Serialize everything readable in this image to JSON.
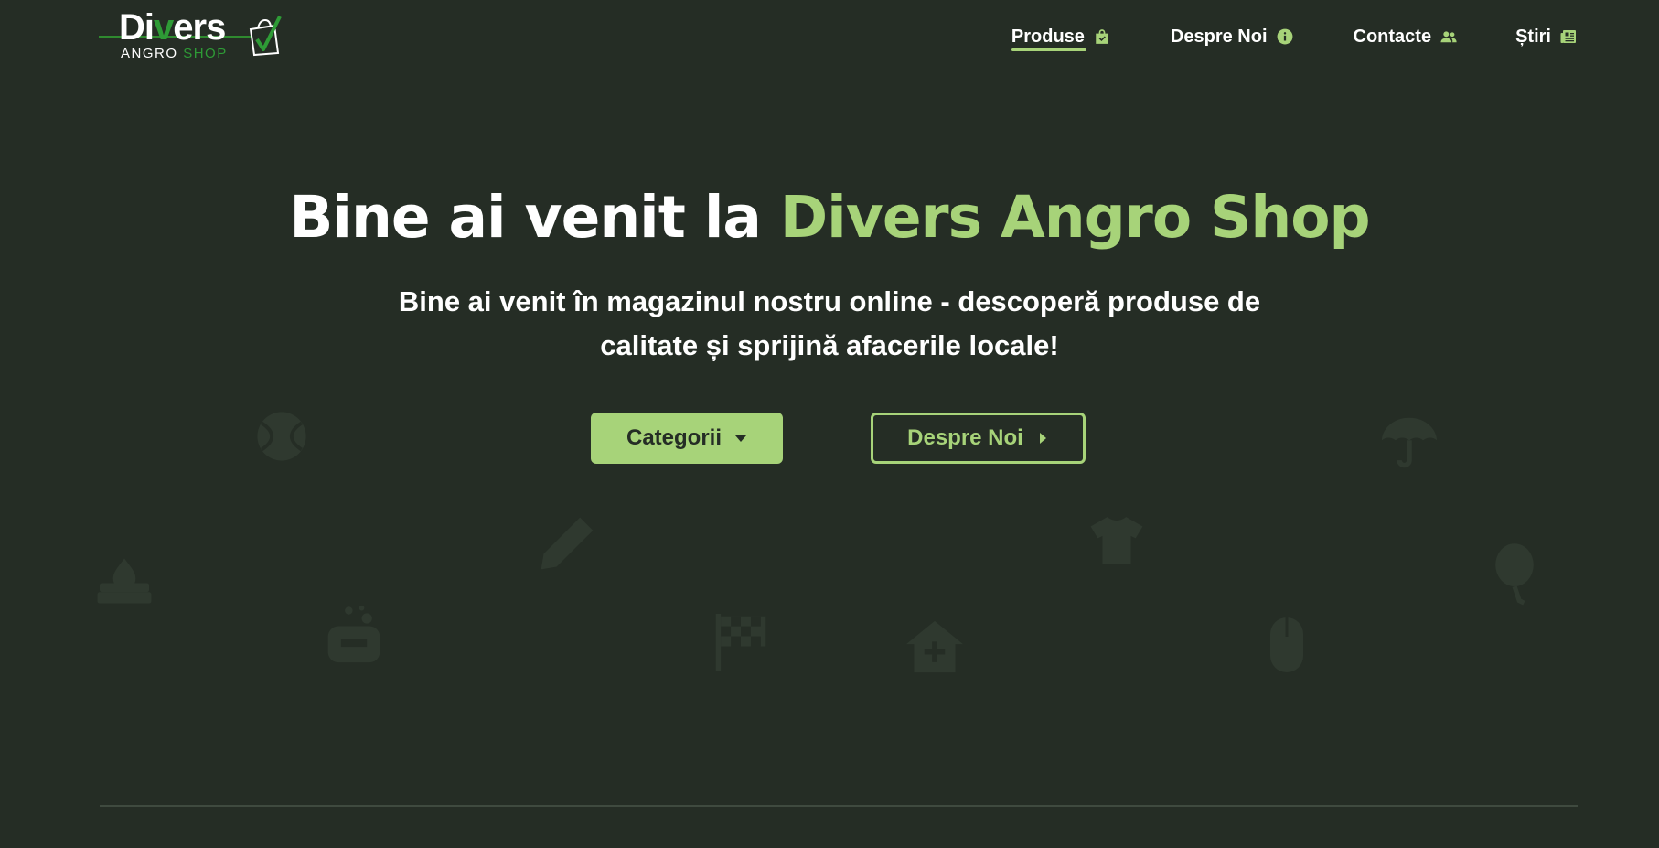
{
  "brand": {
    "logo_main_prefix": "Di",
    "logo_main_accent": "v",
    "logo_main_suffix": "ers",
    "logo_sub_prefix": "ANGRO",
    "logo_sub_accent": "SHOP"
  },
  "nav": {
    "items": [
      {
        "label": "Produse",
        "icon": "shopping-bag-icon",
        "active": true
      },
      {
        "label": "Despre Noi",
        "icon": "info-circle-icon",
        "active": false
      },
      {
        "label": "Contacte",
        "icon": "users-icon",
        "active": false
      },
      {
        "label": "Știri",
        "icon": "newspaper-icon",
        "active": false
      }
    ]
  },
  "hero": {
    "title_prefix": "Bine ai venit la ",
    "title_accent": "Divers Angro Shop",
    "subtitle": "Bine ai venit în magazinul nostru online - descoperă produse de calitate și sprijină afacerile locale!",
    "primary_button": "Categorii",
    "secondary_button": "Despre Noi"
  },
  "background_icons": [
    "tennis-ball-icon",
    "umbrella-icon",
    "stove-icon",
    "pencil-icon",
    "tshirt-icon",
    "balloon-icon",
    "soap-icon",
    "checkered-flag-icon",
    "medical-house-icon",
    "mouse-icon"
  ],
  "colors": {
    "background": "#252d25",
    "accent": "#a7d379",
    "text": "#ffffff",
    "logo_green": "#2e9b36"
  }
}
